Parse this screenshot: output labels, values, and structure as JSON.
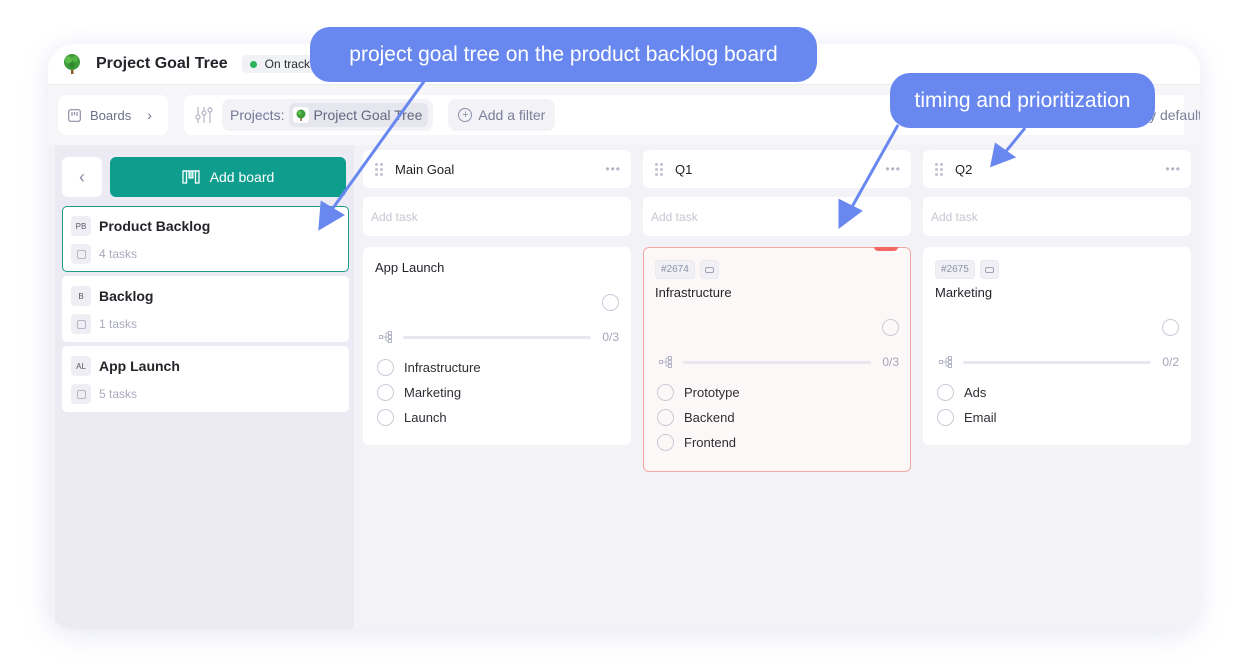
{
  "app": {
    "title": "Project Goal Tree",
    "status": "On track",
    "status_color": "#2cb35b"
  },
  "toolbar": {
    "boards_label": "Boards",
    "projects_label": "Projects:",
    "project_value": "Project Goal Tree",
    "add_filter_label": "Add a filter",
    "sort_label": "Sort by default"
  },
  "sidebar": {
    "add_board_label": "Add board",
    "accent_color": "#0f9d8e",
    "boards": [
      {
        "abbr": "PB",
        "name": "Product Backlog",
        "tasks": "4 tasks",
        "active": true
      },
      {
        "abbr": "B",
        "name": "Backlog",
        "tasks": "1 tasks",
        "active": false
      },
      {
        "abbr": "AL",
        "name": "App Launch",
        "tasks": "5 tasks",
        "active": false
      }
    ]
  },
  "columns": [
    {
      "title": "Main Goal",
      "add_task_placeholder": "Add task",
      "card": {
        "id": null,
        "title": "App Launch",
        "progress_label": "0/3",
        "progress": 0,
        "subtasks": [
          "Infrastructure",
          "Marketing",
          "Launch"
        ]
      }
    },
    {
      "title": "Q1",
      "add_task_placeholder": "Add task",
      "card": {
        "id": "#2674",
        "title": "Infrastructure",
        "flagged": true,
        "progress_label": "0/3",
        "progress": 0,
        "subtasks": [
          "Prototype",
          "Backend",
          "Frontend"
        ]
      }
    },
    {
      "title": "Q2",
      "add_task_placeholder": "Add task",
      "card": {
        "id": "#2675",
        "title": "Marketing",
        "progress_label": "0/2",
        "progress": 0,
        "subtasks": [
          "Ads",
          "Email"
        ]
      }
    }
  ],
  "annotations": [
    {
      "text": "project goal tree on the product backlog board"
    },
    {
      "text": "timing and prioritization"
    }
  ],
  "annotation_color": "#6888f0"
}
